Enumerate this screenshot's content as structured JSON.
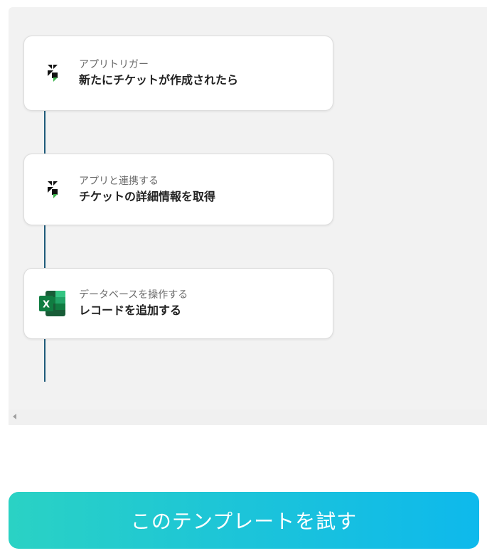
{
  "flow": {
    "steps": [
      {
        "type": "アプリトリガー",
        "title": "新たにチケットが作成されたら",
        "icon": "zendesk-icon"
      },
      {
        "type": "アプリと連携する",
        "title": "チケットの詳細情報を取得",
        "icon": "zendesk-icon"
      },
      {
        "type": "データベースを操作する",
        "title": "レコードを追加する",
        "icon": "excel-icon"
      }
    ]
  },
  "cta": {
    "label": "このテンプレートを試す"
  },
  "colors": {
    "connector": "#1f5b7a",
    "cta_start": "#2ad2c4",
    "cta_end": "#0eb9ec",
    "panel_bg": "#f2f2f2"
  }
}
